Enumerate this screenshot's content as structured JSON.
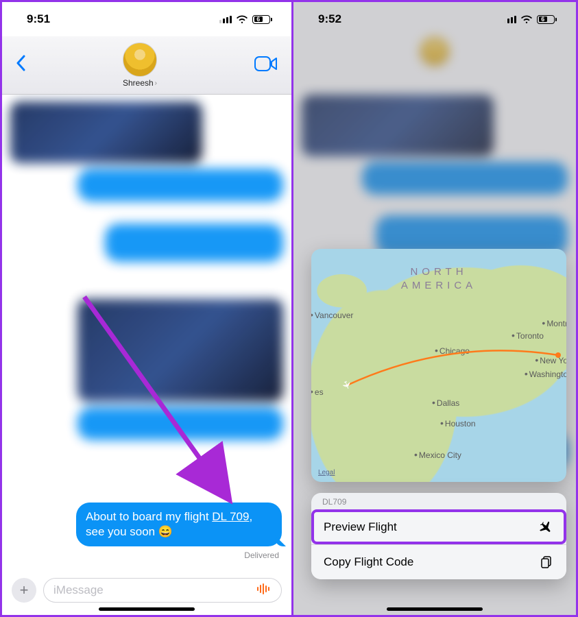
{
  "left": {
    "status": {
      "time": "9:51",
      "battery": "6"
    },
    "header": {
      "contact_name": "Shreesh"
    },
    "message": {
      "prefix": "About to board my flight ",
      "flight_code": "DL 709",
      "suffix": ", see you soon 😄"
    },
    "delivered_label": "Delivered",
    "input_placeholder": "iMessage"
  },
  "right": {
    "status": {
      "time": "9:52",
      "battery": "6"
    },
    "map": {
      "continent_line1": "NORTH",
      "continent_line2": "AMERICA",
      "cities": {
        "vancouver": "Vancouver",
        "chicago": "Chicago",
        "toronto": "Toronto",
        "montreal": "Montr",
        "newyork": "New Yo",
        "washington": "Washingto",
        "dallas": "Dallas",
        "houston": "Houston",
        "mexico": "Mexico City",
        "es": "es"
      },
      "legal": "Legal"
    },
    "menu": {
      "flight_code": "DL709",
      "preview_label": "Preview Flight",
      "copy_label": "Copy Flight Code"
    }
  }
}
